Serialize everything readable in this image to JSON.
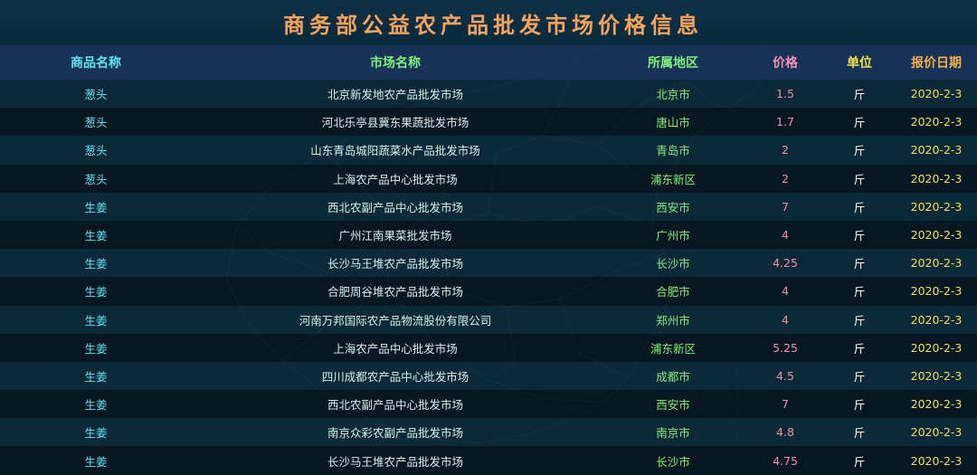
{
  "title": "商务部公益农产品批发市场价格信息",
  "colors": {
    "background": "#07161f",
    "title": "#f5a25a",
    "header_bar": "#19375f",
    "product": "#5fe5ee",
    "market": "#d6f0ee",
    "region": "#7ff07a",
    "price": "#f58faf",
    "unit": "#ffffff",
    "date": "#f3e04a"
  },
  "columns": {
    "name": "商品名称",
    "market": "市场名称",
    "region": "所属地区",
    "price": "价格",
    "unit": "单位",
    "date": "报价日期"
  },
  "rows": [
    {
      "name": "葱头",
      "market": "北京新发地农产品批发市场",
      "region": "北京市",
      "price": "1.5",
      "unit": "斤",
      "date": "2020-2-3"
    },
    {
      "name": "葱头",
      "market": "河北乐亭县冀东果蔬批发市场",
      "region": "唐山市",
      "price": "1.7",
      "unit": "斤",
      "date": "2020-2-3"
    },
    {
      "name": "葱头",
      "market": "山东青岛城阳蔬菜水产品批发市场",
      "region": "青岛市",
      "price": "2",
      "unit": "斤",
      "date": "2020-2-3"
    },
    {
      "name": "葱头",
      "market": "上海农产品中心批发市场",
      "region": "浦东新区",
      "price": "2",
      "unit": "斤",
      "date": "2020-2-3"
    },
    {
      "name": "生姜",
      "market": "西北农副产品中心批发市场",
      "region": "西安市",
      "price": "7",
      "unit": "斤",
      "date": "2020-2-3"
    },
    {
      "name": "生姜",
      "market": "广州江南果菜批发市场",
      "region": "广州市",
      "price": "4",
      "unit": "斤",
      "date": "2020-2-3"
    },
    {
      "name": "生姜",
      "market": "长沙马王堆农产品批发市场",
      "region": "长沙市",
      "price": "4.25",
      "unit": "斤",
      "date": "2020-2-3"
    },
    {
      "name": "生姜",
      "market": "合肥周谷堆农产品批发市场",
      "region": "合肥市",
      "price": "4",
      "unit": "斤",
      "date": "2020-2-3"
    },
    {
      "name": "生姜",
      "market": "河南万邦国际农产品物流股份有限公司",
      "region": "郑州市",
      "price": "4",
      "unit": "斤",
      "date": "2020-2-3"
    },
    {
      "name": "生姜",
      "market": "上海农产品中心批发市场",
      "region": "浦东新区",
      "price": "5.25",
      "unit": "斤",
      "date": "2020-2-3"
    },
    {
      "name": "生姜",
      "market": "四川成都农产品中心批发市场",
      "region": "成都市",
      "price": "4.5",
      "unit": "斤",
      "date": "2020-2-3"
    },
    {
      "name": "生姜",
      "market": "西北农副产品中心批发市场",
      "region": "西安市",
      "price": "7",
      "unit": "斤",
      "date": "2020-2-3"
    },
    {
      "name": "生姜",
      "market": "南京众彩农副产品批发市场",
      "region": "南京市",
      "price": "4.8",
      "unit": "斤",
      "date": "2020-2-3"
    },
    {
      "name": "生姜",
      "market": "长沙马王堆农产品批发市场",
      "region": "长沙市",
      "price": "4.75",
      "unit": "斤",
      "date": "2020-2-3"
    }
  ]
}
